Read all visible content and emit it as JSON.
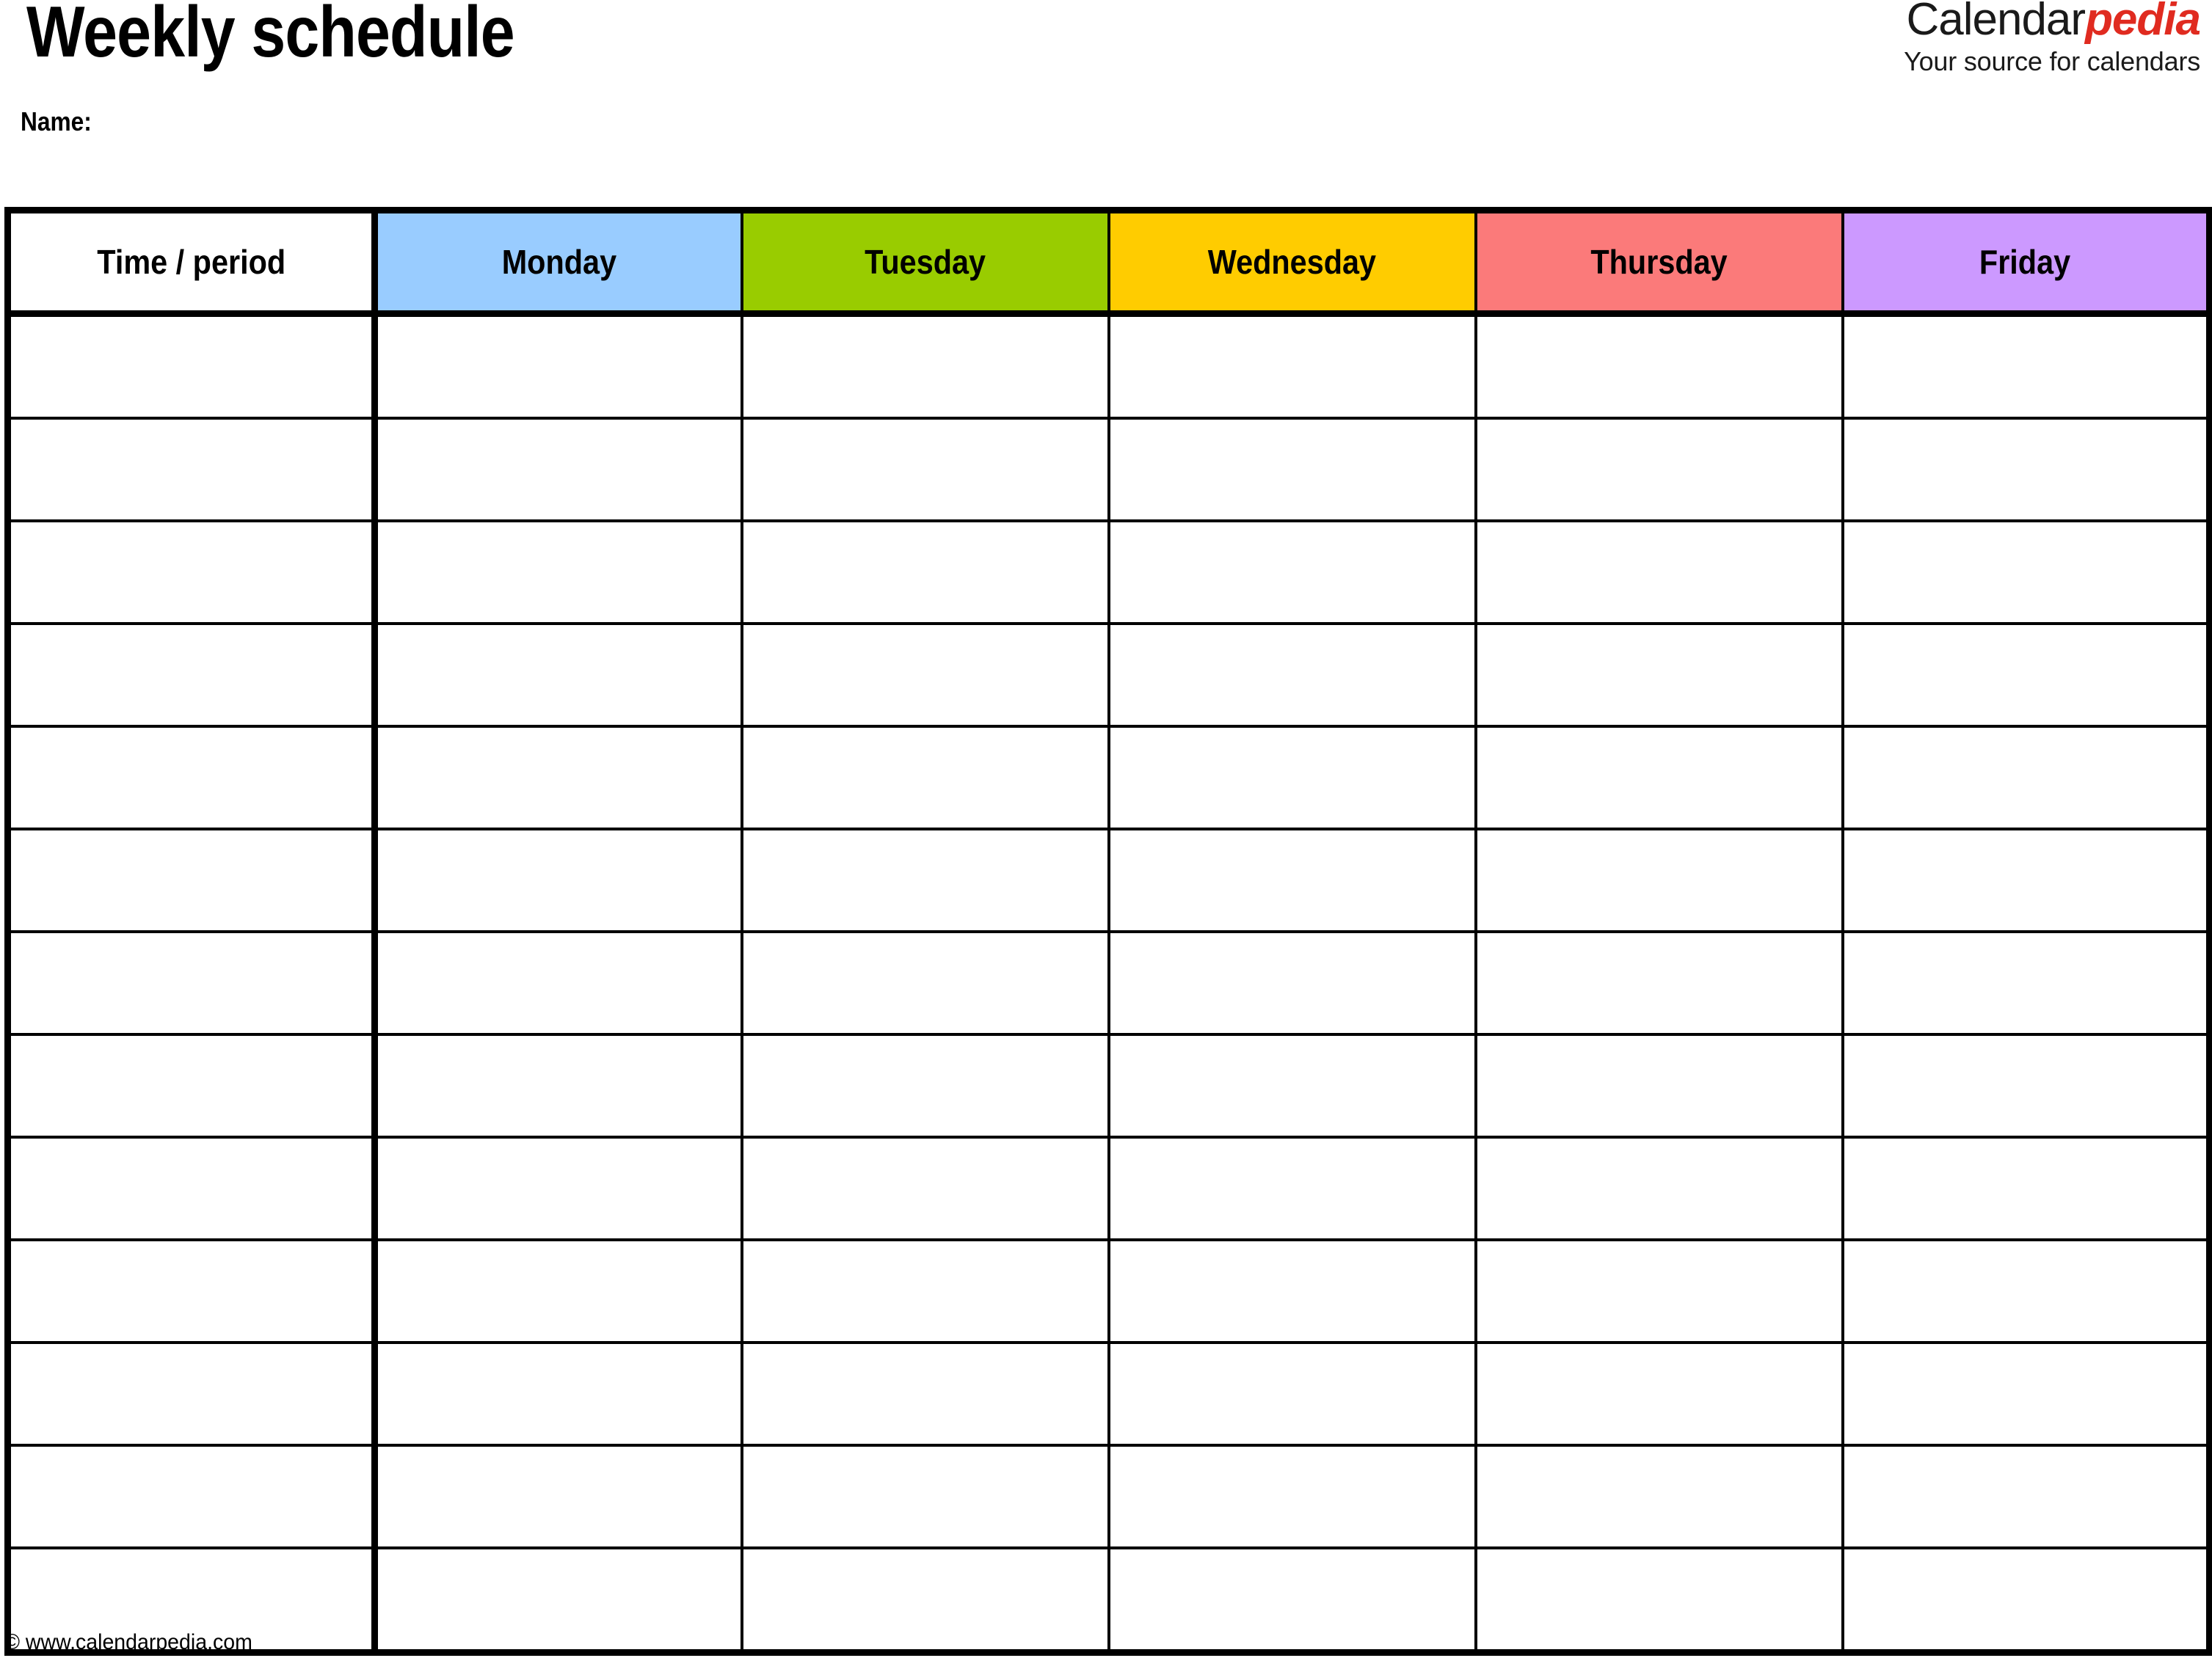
{
  "document": {
    "title": "Weekly schedule",
    "name_label": "Name:"
  },
  "logo": {
    "brand_part1": "Calendar",
    "brand_part2": "pedia",
    "tagline": "Your source for calendars",
    "accent_color": "#e02b20"
  },
  "table": {
    "columns": [
      {
        "label": "Time / period",
        "bg": "#ffffff"
      },
      {
        "label": "Monday",
        "bg": "#99ccff"
      },
      {
        "label": "Tuesday",
        "bg": "#99cc00"
      },
      {
        "label": "Wednesday",
        "bg": "#ffcc00"
      },
      {
        "label": "Thursday",
        "bg": "#fb7a7a"
      },
      {
        "label": "Friday",
        "bg": "#cc99ff"
      }
    ],
    "row_count": 13,
    "rows": [
      [
        "",
        "",
        "",
        "",
        "",
        ""
      ],
      [
        "",
        "",
        "",
        "",
        "",
        ""
      ],
      [
        "",
        "",
        "",
        "",
        "",
        ""
      ],
      [
        "",
        "",
        "",
        "",
        "",
        ""
      ],
      [
        "",
        "",
        "",
        "",
        "",
        ""
      ],
      [
        "",
        "",
        "",
        "",
        "",
        ""
      ],
      [
        "",
        "",
        "",
        "",
        "",
        ""
      ],
      [
        "",
        "",
        "",
        "",
        "",
        ""
      ],
      [
        "",
        "",
        "",
        "",
        "",
        ""
      ],
      [
        "",
        "",
        "",
        "",
        "",
        ""
      ],
      [
        "",
        "",
        "",
        "",
        "",
        ""
      ],
      [
        "",
        "",
        "",
        "",
        "",
        ""
      ],
      [
        "",
        "",
        "",
        "",
        "",
        ""
      ]
    ]
  },
  "footer": {
    "copyright": "© www.calendarpedia.com"
  }
}
